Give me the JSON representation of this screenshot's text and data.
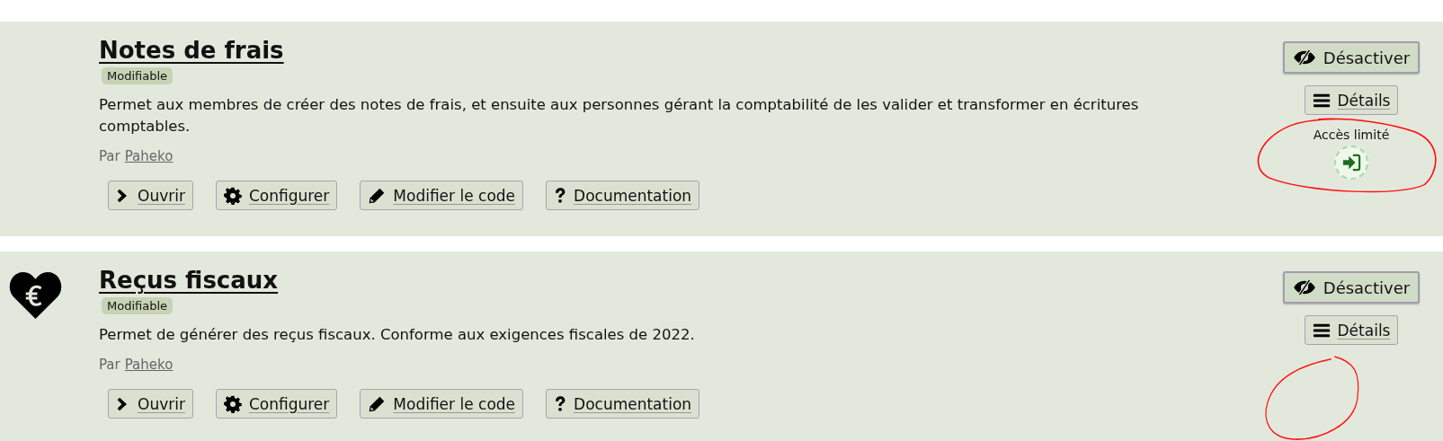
{
  "cards": [
    {
      "title": "Notes de frais",
      "badge": "Modifiable",
      "description": "Permet aux membres de créer des notes de frais, et ensuite aux personnes gérant la comptabilité de les valider et transformer en écritures comptables.",
      "author_prefix": "Par",
      "author": "Paheko",
      "actions": [
        {
          "kind": "open",
          "label": "Ouvrir"
        },
        {
          "kind": "configure",
          "label": "Configurer"
        },
        {
          "kind": "edit",
          "label": "Modifier le code"
        },
        {
          "kind": "docs",
          "label": "Documentation"
        }
      ],
      "toggle_button": "Désactiver",
      "details_button": "Détails",
      "access": {
        "label": "Accès limité"
      },
      "circled": true
    },
    {
      "icon": {
        "kind": "heart-euro"
      },
      "title": "Reçus fiscaux",
      "badge": "Modifiable",
      "description": "Permet de générer des reçus fiscaux. Conforme aux exigences fiscales de 2022.",
      "author_prefix": "Par",
      "author": "Paheko",
      "actions": [
        {
          "kind": "open",
          "label": "Ouvrir"
        },
        {
          "kind": "configure",
          "label": "Configurer"
        },
        {
          "kind": "edit",
          "label": "Modifier le code"
        },
        {
          "kind": "docs",
          "label": "Documentation"
        }
      ],
      "toggle_button": "Désactiver",
      "details_button": "Détails",
      "circled": true
    }
  ]
}
